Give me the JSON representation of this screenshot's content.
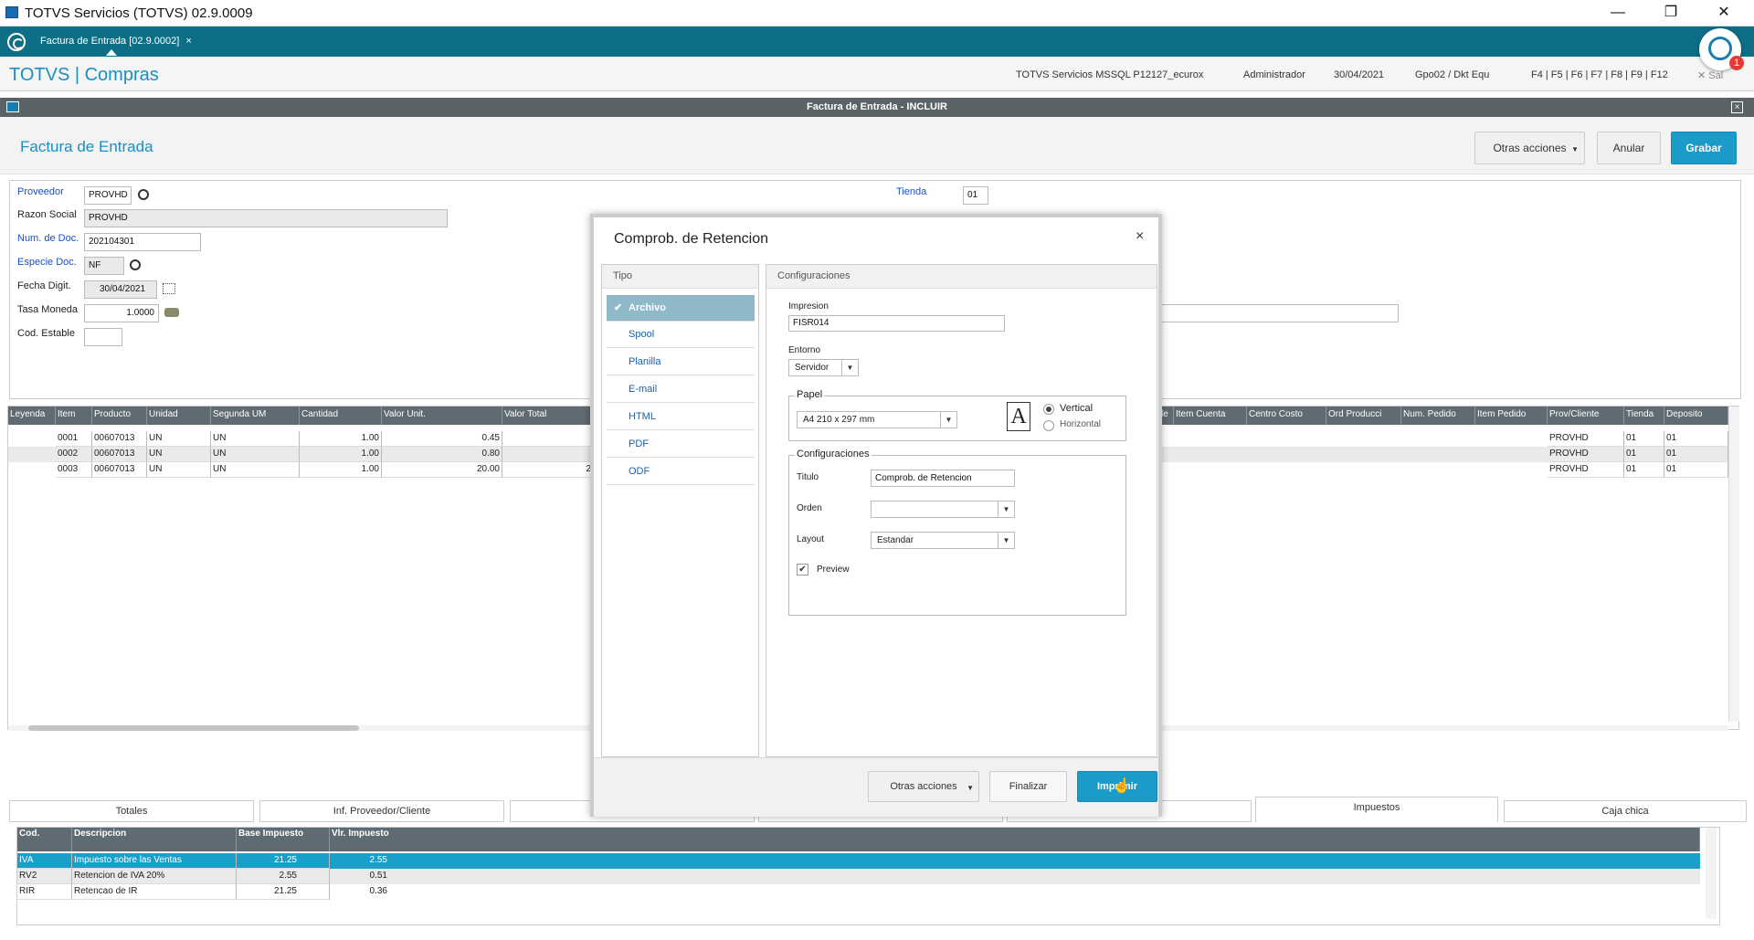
{
  "titlebar": {
    "title": "TOTVS Servicios (TOTVS) 02.9.0009",
    "min": "—",
    "restore": "❐",
    "close": "✕"
  },
  "tabbar": {
    "tab_label": "Factura de Entrada [02.9.0002]",
    "tab_close": "×",
    "badge": "1"
  },
  "header": {
    "brand": "TOTVS | Compras",
    "environment": "TOTVS Servicios MSSQL P12127_ecurox",
    "user": "Administrador",
    "date": "30/04/2021",
    "company": "Gpo02 / Dkt Equ",
    "shortcuts": "F4 | F5 | F6 | F7 | F8 | F9 | F12",
    "exit": "✕ Sal"
  },
  "window": {
    "caption": "Factura de Entrada - INCLUIR",
    "close": "×"
  },
  "formhead": {
    "title": "Factura de Entrada",
    "more_actions": "Otras acciones",
    "cancel": "Anular",
    "save": "Grabar"
  },
  "form": {
    "proveedor_label": "Proveedor",
    "proveedor_value": "PROVHD",
    "razon_label": "Razon Social",
    "razon_value": "PROVHD",
    "numdoc_label": "Num. de Doc.",
    "numdoc_value": "202104301",
    "especie_label": "Especie Doc.",
    "especie_value": "NF",
    "fecha_label": "Fecha Digit.",
    "fecha_value": "30/04/2021",
    "tasa_label": "Tasa Moneda",
    "tasa_value": "1.0000",
    "estable_label": "Cod. Estable",
    "estable_value": "",
    "tienda_label": "Tienda",
    "tienda_value": "01"
  },
  "grid": {
    "left_headers": [
      "Leyenda",
      "Item",
      "Producto",
      "Unidad",
      "Segunda UM",
      "Cantidad",
      "Valor Unit.",
      "Valor Total"
    ],
    "right_headers": [
      "le",
      "Item Cuenta",
      "Centro Costo",
      "Ord Producci",
      "Num. Pedido",
      "Item Pedido",
      "Prov/Cliente",
      "Tienda",
      "Deposito"
    ],
    "rows": [
      {
        "item": "0001",
        "producto": "00607013",
        "unidad": "UN",
        "segunda": "UN",
        "cantidad": "1.00",
        "unit": "0.45",
        "total": "",
        "prov": "PROVHD",
        "tienda": "01",
        "deposito": "01"
      },
      {
        "item": "0002",
        "producto": "00607013",
        "unidad": "UN",
        "segunda": "UN",
        "cantidad": "1.00",
        "unit": "0.80",
        "total": "",
        "prov": "PROVHD",
        "tienda": "01",
        "deposito": "01"
      },
      {
        "item": "0003",
        "producto": "00607013",
        "unidad": "UN",
        "segunda": "UN",
        "cantidad": "1.00",
        "unit": "20.00",
        "total": "2",
        "prov": "PROVHD",
        "tienda": "01",
        "deposito": "01"
      }
    ]
  },
  "bottom_tabs": [
    "Totales",
    "Inf. Proveedor/Cliente",
    "Impuestos",
    "Caja chica"
  ],
  "tax": {
    "headers": [
      "Cod.",
      "Descripcion",
      "Base Impuesto",
      "Vlr. Impuesto"
    ],
    "rows": [
      {
        "cod": "IVA",
        "desc": "Impuesto sobre las Ventas",
        "base": "21.25",
        "vlr": "2.55"
      },
      {
        "cod": "RV2",
        "desc": "Retencion de IVA 20%",
        "base": "2.55",
        "vlr": "0.51"
      },
      {
        "cod": "RIR",
        "desc": "Retencao de IR",
        "base": "21.25",
        "vlr": "0.36"
      }
    ]
  },
  "modal": {
    "title": "Comprob. de Retencion",
    "close": "×",
    "tipo_header": "Tipo",
    "tipo_items": [
      "Archivo",
      "Spool",
      "Planilla",
      "E-mail",
      "HTML",
      "PDF",
      "ODF"
    ],
    "config_header": "Configuraciones",
    "impresion_label": "Impresion",
    "impresion_value": "FISR014",
    "entorno_label": "Entorno",
    "entorno_value": "Servidor",
    "papel_legend": "Papel",
    "papel_value": "A4 210 x 297 mm",
    "vertical": "Vertical",
    "horizontal": "Horizontal",
    "config_legend": "Configuraciones",
    "titulo_label": "Titulo",
    "titulo_value": "Comprob. de Retencion",
    "orden_label": "Orden",
    "orden_value": "",
    "layout_label": "Layout",
    "layout_value": "Estandar",
    "preview_label": "Preview",
    "more_actions": "Otras acciones",
    "finalizar": "Finalizar",
    "imprimir": "Imprimir"
  }
}
